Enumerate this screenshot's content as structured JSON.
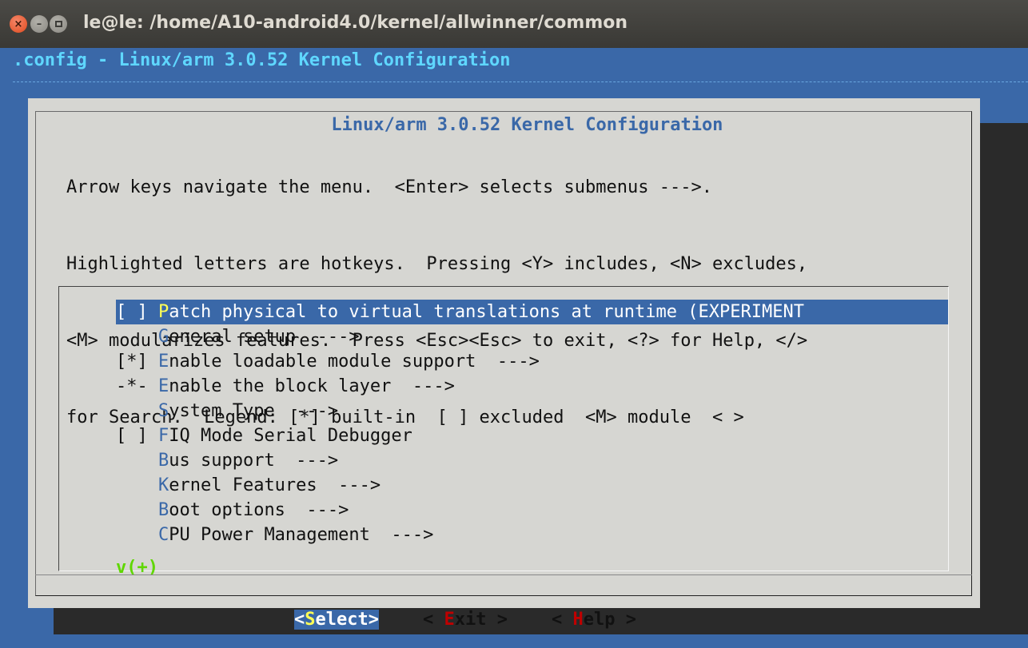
{
  "window": {
    "title": "le@le: /home/A10-android4.0/kernel/allwinner/common",
    "close_glyph": "×",
    "minimize_glyph": "–"
  },
  "terminal": {
    "config_title": ".config - Linux/arm 3.0.52 Kernel Configuration"
  },
  "dialog": {
    "title": "Linux/arm 3.0.52 Kernel Configuration",
    "help_lines": [
      "Arrow keys navigate the menu.  <Enter> selects submenus --->.",
      "Highlighted letters are hotkeys.  Pressing <Y> includes, <N> excludes,",
      "<M> modularizes features.  Press <Esc><Esc> to exit, <?> for Help, </>",
      "for Search.  Legend: [*] built-in  [ ] excluded  <M> module  < >"
    ],
    "more_indicator": "v(+)"
  },
  "menu": {
    "items": [
      {
        "mark": "[ ] ",
        "hotkey": "P",
        "rest": "atch physical to virtual translations at runtime (EXPERIMENT",
        "selected": true
      },
      {
        "mark": "    ",
        "hotkey": "G",
        "rest": "eneral setup  --->",
        "selected": false
      },
      {
        "mark": "[*] ",
        "hotkey": "E",
        "rest": "nable loadable module support  --->",
        "selected": false
      },
      {
        "mark": "-*- ",
        "hotkey": "E",
        "rest": "nable the block layer  --->",
        "selected": false
      },
      {
        "mark": "    ",
        "hotkey": "S",
        "rest": "ystem Type  --->",
        "selected": false
      },
      {
        "mark": "[ ] ",
        "hotkey": "F",
        "rest": "IQ Mode Serial Debugger",
        "selected": false
      },
      {
        "mark": "    ",
        "hotkey": "B",
        "rest": "us support  --->",
        "selected": false
      },
      {
        "mark": "    ",
        "hotkey": "K",
        "rest": "ernel Features  --->",
        "selected": false
      },
      {
        "mark": "    ",
        "hotkey": "B",
        "rest": "oot options  --->",
        "selected": false
      },
      {
        "mark": "    ",
        "hotkey": "C",
        "rest": "PU Power Management  --->",
        "selected": false
      }
    ]
  },
  "buttons": {
    "select": {
      "prefix": "<",
      "hotkey": "S",
      "rest": "elect>"
    },
    "exit": {
      "prefix": "< ",
      "hotkey": "E",
      "rest": "xit >"
    },
    "help": {
      "prefix": "< ",
      "hotkey": "H",
      "rest": "elp >"
    }
  },
  "colors": {
    "terminal_blue": "#3a68a8",
    "dialog_gray": "#d6d6d2",
    "title_cyan": "#5fd7ff",
    "hotkey_red": "#c00000",
    "hotkey_yellow": "#ffff55",
    "indicator_green": "#5fd700"
  }
}
